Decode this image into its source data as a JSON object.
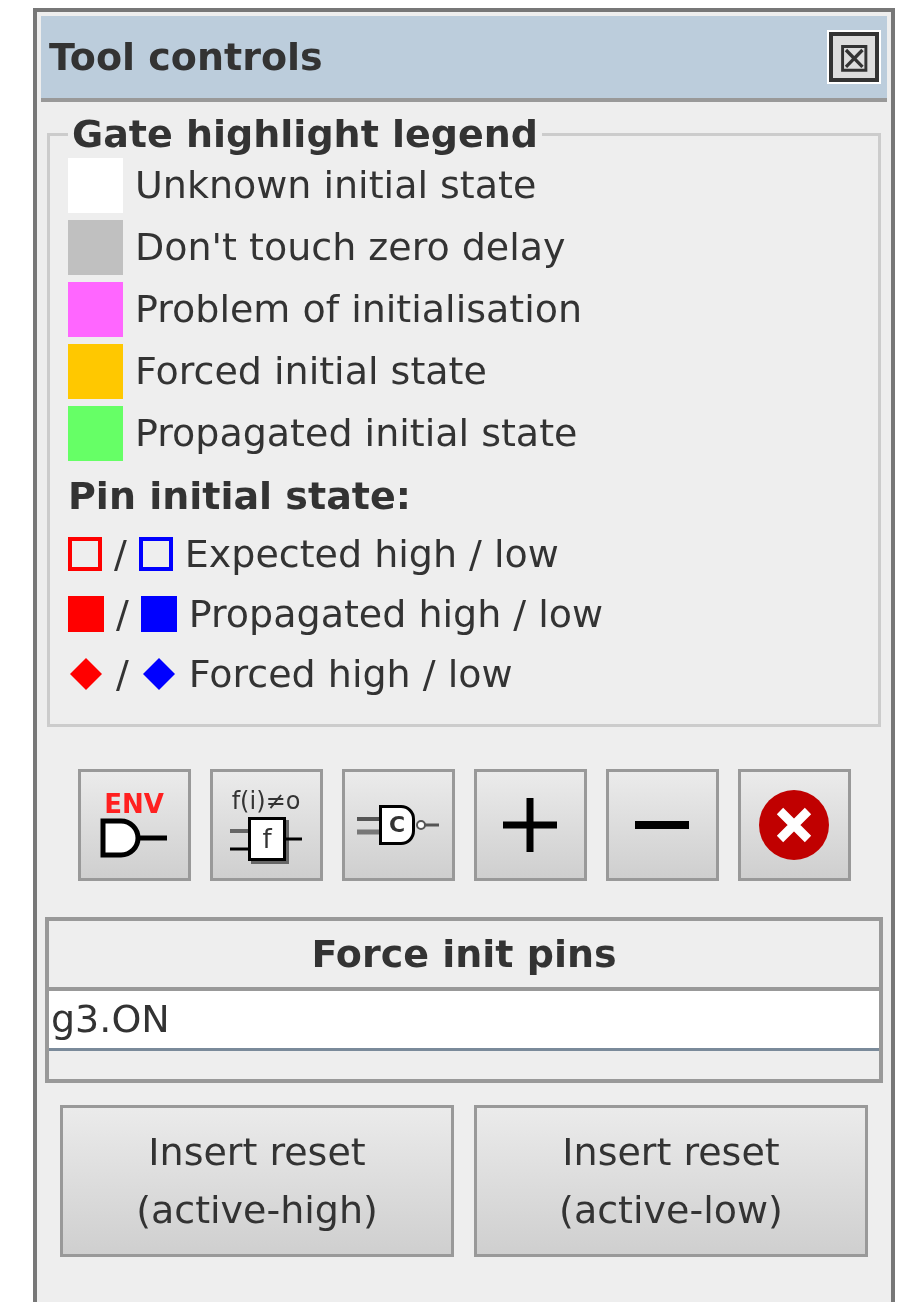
{
  "window": {
    "title": "Tool controls",
    "close_symbol": "⊠"
  },
  "legend": {
    "title": "Gate highlight legend",
    "items": [
      {
        "color": "#ffffff",
        "label": "Unknown initial state"
      },
      {
        "color": "#c0c0c0",
        "label": "Don't touch zero delay"
      },
      {
        "color": "#ff66ff",
        "label": "Problem of initialisation"
      },
      {
        "color": "#ffc800",
        "label": "Forced initial state"
      },
      {
        "color": "#66ff66",
        "label": "Propagated initial state"
      }
    ],
    "pin_heading": "Pin initial state:",
    "pins": [
      {
        "kind": "outline",
        "markers": [
          {
            "color": "#ff0000"
          },
          {
            "color": "#0000ff"
          }
        ],
        "separator": "/",
        "label": "Expected high / low"
      },
      {
        "kind": "filled",
        "markers": [
          {
            "color": "#ff0000"
          },
          {
            "color": "#0000ff"
          }
        ],
        "separator": "/",
        "label": "Propagated high / low"
      },
      {
        "kind": "diamond",
        "markers": [
          {
            "color": "#ff0000"
          },
          {
            "color": "#0000ff"
          }
        ],
        "separator": "/",
        "label": "Forced high / low"
      }
    ]
  },
  "toolbar": [
    {
      "kind": "env",
      "caption": "ENV"
    },
    {
      "kind": "function",
      "caption": "f(i)≠o",
      "inner": "f"
    },
    {
      "kind": "c-gate",
      "inner": "C"
    },
    {
      "kind": "plus"
    },
    {
      "kind": "minus"
    },
    {
      "kind": "delete"
    }
  ],
  "table": {
    "columns": [
      "Force init pins"
    ],
    "rows": [
      "g3.ON"
    ]
  },
  "buttons": [
    {
      "line1": "Insert reset",
      "line2": "(active-high)"
    },
    {
      "line1": "Insert reset",
      "line2": "(active-low)"
    }
  ]
}
